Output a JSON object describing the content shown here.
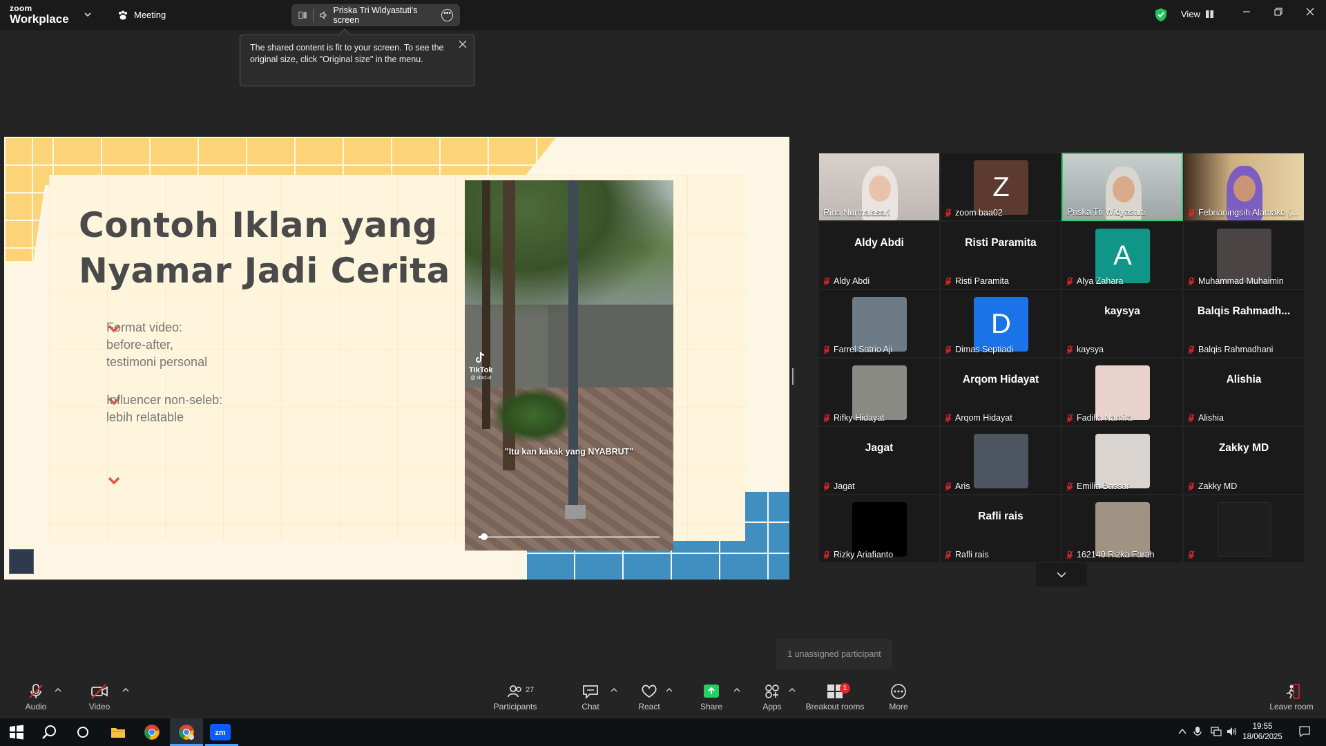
{
  "titlebar": {
    "brand_top": "zoom",
    "brand_bottom": "Workplace",
    "meeting_label": "Meeting",
    "share_label": "Priska Tri Widyastuti's screen",
    "view_label": "View"
  },
  "tooltip": {
    "text": "The shared content is fit to your screen. To see the original size, click \"Original size\" in the menu."
  },
  "slide": {
    "title_line1": "Contoh Iklan yang",
    "title_line2": "Nyamar Jadi Cerita",
    "bullets": [
      {
        "line1": "Format video:",
        "line2": "before-after,",
        "line3": "testimoni personal"
      },
      {
        "line1": "Influencer non-seleb:",
        "line2": "lebih relatable"
      },
      {
        "line1": ""
      }
    ],
    "video": {
      "watermark": "TikTok",
      "watermark_handle": "@ shrd.id",
      "caption": "\"Itu kan kakak yang NYABRUT\"",
      "progress": 0.03
    }
  },
  "participants": [
    {
      "name": "Rina Nurmalasari",
      "type": "video",
      "muted": false
    },
    {
      "name": "zoom baa02",
      "type": "avatar",
      "letter": "Z",
      "color": "#5c3a30",
      "muted": true
    },
    {
      "name": "Priska Tri Widyastuti",
      "type": "video",
      "active": true,
      "muted": false
    },
    {
      "name": "Febrianingsih Alamako (...",
      "type": "video",
      "muted": true
    },
    {
      "name": "Aldy Abdi",
      "display": "Aldy Abdi",
      "type": "name",
      "muted": true
    },
    {
      "name": "Risti Paramita",
      "display": "Risti Paramita",
      "type": "name",
      "muted": true
    },
    {
      "name": "Alya Zahara",
      "type": "avatar",
      "letter": "A",
      "color": "#0f9688",
      "muted": true
    },
    {
      "name": "Muhammad Muhaimin",
      "type": "photo",
      "color": "#4a4444",
      "muted": true
    },
    {
      "name": "Farrel Satrio Aji",
      "type": "photo",
      "color": "#6c7b86",
      "muted": true
    },
    {
      "name": "Dimas Septiadi",
      "type": "avatar",
      "letter": "D",
      "color": "#1a73e8",
      "muted": true
    },
    {
      "name": "kaysya",
      "display": "kaysya",
      "type": "name",
      "muted": true
    },
    {
      "name": "Balqis Rahmadhani",
      "display": "Balqis  Rahmadh...",
      "type": "name",
      "muted": true
    },
    {
      "name": "Rifky Hidayat",
      "type": "photo",
      "color": "#8a8a85",
      "muted": true
    },
    {
      "name": "Arqom Hidayat",
      "display": "Arqom Hidayat",
      "type": "name",
      "muted": true
    },
    {
      "name": "Fadilla Namira",
      "type": "photo",
      "color": "#e9d2cc",
      "muted": true
    },
    {
      "name": "Alishia",
      "display": "Alishia",
      "type": "name",
      "muted": true
    },
    {
      "name": "Jagat",
      "display": "Jagat",
      "type": "name",
      "muted": true
    },
    {
      "name": "Aris",
      "type": "photo",
      "color": "#4d5660",
      "muted": true
    },
    {
      "name": "Emilia Bassar",
      "type": "photo",
      "color": "#d9d4cf",
      "muted": true
    },
    {
      "name": "Zakky MD",
      "display": "Zakky MD",
      "type": "name",
      "muted": true
    },
    {
      "name": "Rizky Ariafianto",
      "type": "photo",
      "color": "#000000",
      "muted": true
    },
    {
      "name": "Rafli rais",
      "display": "Rafli rais",
      "type": "name",
      "muted": true
    },
    {
      "name": "162140  Rizka Farah",
      "type": "photo",
      "color": "#a09383",
      "muted": true
    },
    {
      "name": "",
      "type": "empty",
      "muted": true
    }
  ],
  "unassigned": "1 unassigned participant",
  "toolbar": {
    "audio": "Audio",
    "video": "Video",
    "participants": "Participants",
    "participants_count": "27",
    "chat": "Chat",
    "react": "React",
    "share": "Share",
    "apps": "Apps",
    "breakout": "Breakout rooms",
    "breakout_badge": "1",
    "more": "More",
    "leave": "Leave room"
  },
  "taskbar": {
    "time": "19:55",
    "date": "18/06/2025"
  },
  "colors": {
    "accent_green": "#2ecc71",
    "share_green": "#23d160",
    "mute_red": "#e02828",
    "slide_yellow": "#fcd477",
    "slide_blue": "#3f8fc1",
    "bullet_red": "#e2564b"
  }
}
